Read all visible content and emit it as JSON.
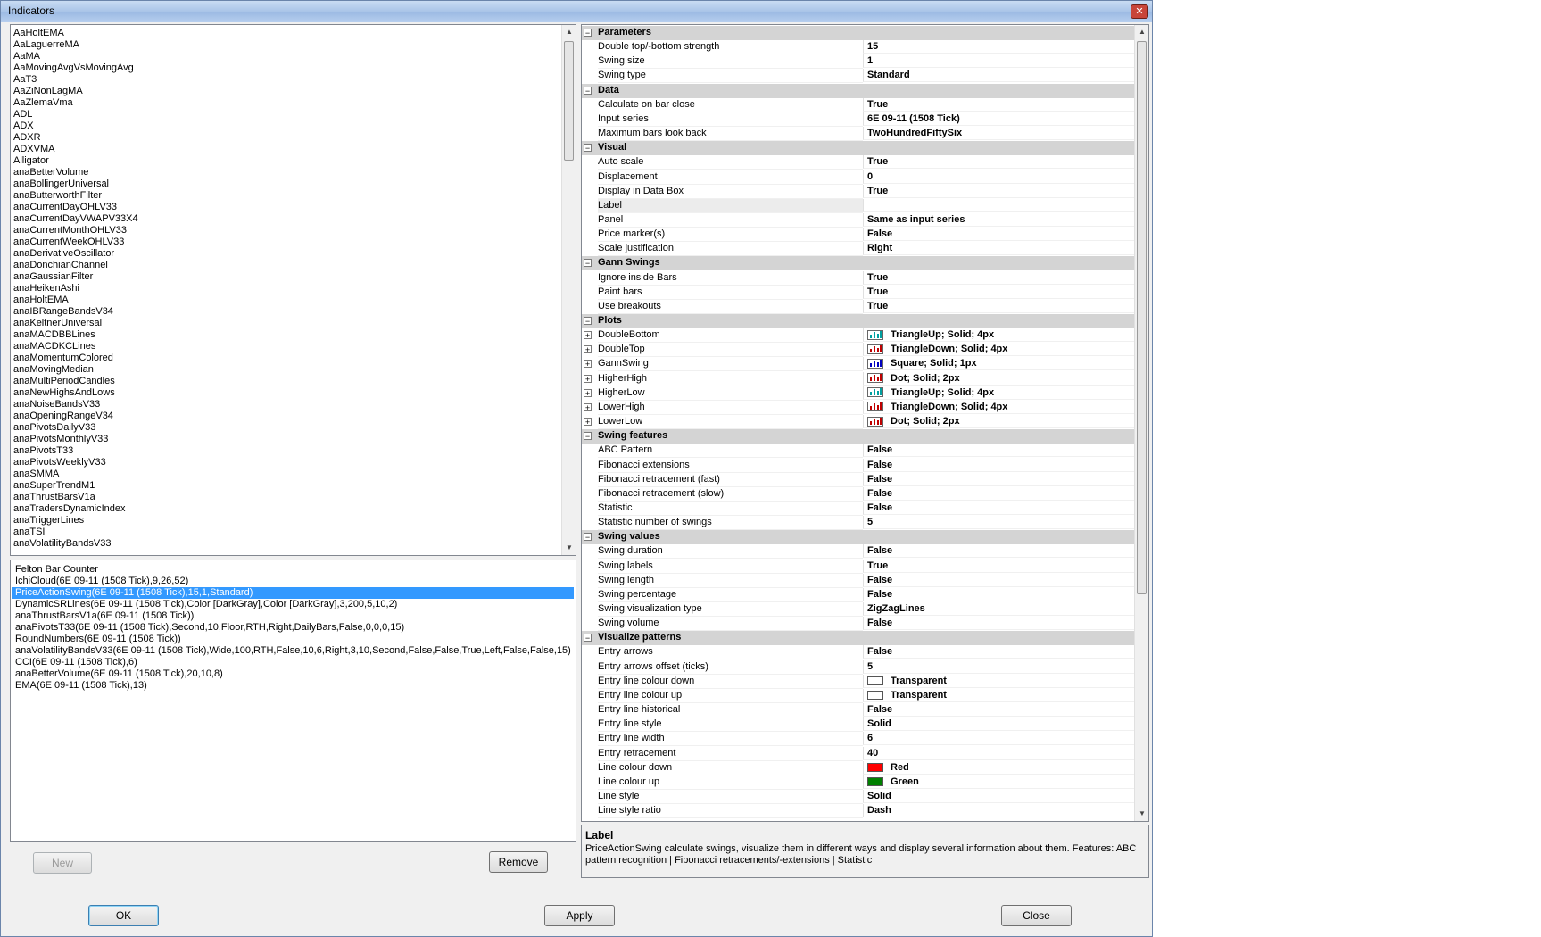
{
  "window": {
    "title": "Indicators",
    "close_glyph": "✕"
  },
  "indicator_list": [
    "AaHoltEMA",
    "AaLaguerreMA",
    "AaMA",
    "AaMovingAvgVsMovingAvg",
    "AaT3",
    "AaZiNonLagMA",
    "AaZlemaVma",
    "ADL",
    "ADX",
    "ADXR",
    "ADXVMA",
    "Alligator",
    "anaBetterVolume",
    "anaBollingerUniversal",
    "anaButterworthFilter",
    "anaCurrentDayOHLV33",
    "anaCurrentDayVWAPV33X4",
    "anaCurrentMonthOHLV33",
    "anaCurrentWeekOHLV33",
    "anaDerivativeOscillator",
    "anaDonchianChannel",
    "anaGaussianFilter",
    "anaHeikenAshi",
    "anaHoltEMA",
    "anaIBRangeBandsV34",
    "anaKeltnerUniversal",
    "anaMACDBBLines",
    "anaMACDKCLines",
    "anaMomentumColored",
    "anaMovingMedian",
    "anaMultiPeriodCandles",
    "anaNewHighsAndLows",
    "anaNoiseBandsV33",
    "anaOpeningRangeV34",
    "anaPivotsDailyV33",
    "anaPivotsMonthlyV33",
    "anaPivotsT33",
    "anaPivotsWeeklyV33",
    "anaSMMA",
    "anaSuperTrendM1",
    "anaThrustBarsV1a",
    "anaTradersDynamicIndex",
    "anaTriggerLines",
    "anaTSI",
    "anaVolatilityBandsV33"
  ],
  "applied_list": {
    "selected_index": 2,
    "items": [
      "Felton Bar Counter",
      "IchiCloud(6E 09-11 (1508 Tick),9,26,52)",
      "PriceActionSwing(6E 09-11 (1508 Tick),15,1,Standard)",
      "DynamicSRLines(6E 09-11 (1508 Tick),Color [DarkGray],Color [DarkGray],3,200,5,10,2)",
      "anaThrustBarsV1a(6E 09-11 (1508 Tick))",
      "anaPivotsT33(6E 09-11 (1508 Tick),Second,10,Floor,RTH,Right,DailyBars,False,0,0,0,15)",
      "RoundNumbers(6E 09-11 (1508 Tick))",
      "anaVolatilityBandsV33(6E 09-11 (1508 Tick),Wide,100,RTH,False,10,6,Right,3,10,Second,False,False,True,Left,False,False,15)",
      "CCI(6E 09-11 (1508 Tick),6)",
      "anaBetterVolume(6E 09-11 (1508 Tick),20,10,8)",
      "EMA(6E 09-11 (1508 Tick),13)"
    ]
  },
  "buttons": {
    "new": "New",
    "remove": "Remove",
    "ok": "OK",
    "apply": "Apply",
    "close": "Close"
  },
  "property_grid": [
    {
      "category": "Parameters",
      "props": [
        {
          "name": "Double top/-bottom strength",
          "value": "15"
        },
        {
          "name": "Swing size",
          "value": "1"
        },
        {
          "name": "Swing type",
          "value": "Standard"
        }
      ]
    },
    {
      "category": "Data",
      "props": [
        {
          "name": "Calculate on bar close",
          "value": "True"
        },
        {
          "name": "Input series",
          "value": "6E 09-11 (1508 Tick)"
        },
        {
          "name": "Maximum bars look back",
          "value": "TwoHundredFiftySix"
        }
      ]
    },
    {
      "category": "Visual",
      "props": [
        {
          "name": "Auto scale",
          "value": "True"
        },
        {
          "name": "Displacement",
          "value": "0"
        },
        {
          "name": "Display in Data Box",
          "value": "True"
        },
        {
          "name": "Label",
          "value": "",
          "shaded": true
        },
        {
          "name": "Panel",
          "value": "Same as input series"
        },
        {
          "name": "Price marker(s)",
          "value": "False"
        },
        {
          "name": "Scale justification",
          "value": "Right"
        }
      ]
    },
    {
      "category": "Gann Swings",
      "props": [
        {
          "name": "Ignore inside Bars",
          "value": "True"
        },
        {
          "name": "Paint bars",
          "value": "True"
        },
        {
          "name": "Use breakouts",
          "value": "True"
        }
      ]
    },
    {
      "category": "Plots",
      "props": [
        {
          "name": "DoubleBottom",
          "value": "TriangleUp; Solid; 4px",
          "expand": true,
          "plot_color": "#00a0a0"
        },
        {
          "name": "DoubleTop",
          "value": "TriangleDown; Solid; 4px",
          "expand": true,
          "plot_color": "#c00000"
        },
        {
          "name": "GannSwing",
          "value": "Square; Solid; 1px",
          "expand": true,
          "plot_color": "#0000c0"
        },
        {
          "name": "HigherHigh",
          "value": "Dot; Solid; 2px",
          "expand": true,
          "plot_color": "#c00000"
        },
        {
          "name": "HigherLow",
          "value": "TriangleUp; Solid; 4px",
          "expand": true,
          "plot_color": "#00a0a0"
        },
        {
          "name": "LowerHigh",
          "value": "TriangleDown; Solid; 4px",
          "expand": true,
          "plot_color": "#c00000"
        },
        {
          "name": "LowerLow",
          "value": "Dot; Solid; 2px",
          "expand": true,
          "plot_color": "#c00000"
        }
      ]
    },
    {
      "category": "Swing features",
      "props": [
        {
          "name": "ABC Pattern",
          "value": "False"
        },
        {
          "name": "Fibonacci extensions",
          "value": "False"
        },
        {
          "name": "Fibonacci retracement (fast)",
          "value": "False"
        },
        {
          "name": "Fibonacci retracement (slow)",
          "value": "False"
        },
        {
          "name": "Statistic",
          "value": "False"
        },
        {
          "name": "Statistic number of swings",
          "value": "5"
        }
      ]
    },
    {
      "category": "Swing values",
      "props": [
        {
          "name": "Swing duration",
          "value": "False"
        },
        {
          "name": "Swing labels",
          "value": "True"
        },
        {
          "name": "Swing length",
          "value": "False"
        },
        {
          "name": "Swing percentage",
          "value": "False"
        },
        {
          "name": "Swing visualization type",
          "value": "ZigZagLines"
        },
        {
          "name": "Swing volume",
          "value": "False"
        }
      ]
    },
    {
      "category": "Visualize patterns",
      "props": [
        {
          "name": "Entry arrows",
          "value": "False"
        },
        {
          "name": "Entry arrows offset (ticks)",
          "value": "5"
        },
        {
          "name": "Entry line colour down",
          "value": "Transparent",
          "color": "#ffffff"
        },
        {
          "name": "Entry line colour up",
          "value": "Transparent",
          "color": "#ffffff"
        },
        {
          "name": "Entry line historical",
          "value": "False"
        },
        {
          "name": "Entry line style",
          "value": "Solid"
        },
        {
          "name": "Entry line width",
          "value": "6"
        },
        {
          "name": "Entry retracement",
          "value": "40"
        },
        {
          "name": "Line colour down",
          "value": "Red",
          "color": "#ff0000"
        },
        {
          "name": "Line colour up",
          "value": "Green",
          "color": "#008000"
        },
        {
          "name": "Line style",
          "value": "Solid"
        },
        {
          "name": "Line style ratio",
          "value": "Dash"
        }
      ]
    }
  ],
  "description": {
    "title": "Label",
    "text": "PriceActionSwing calculate swings, visualize them in different ways and display several information about them. Features: ABC pattern recognition | Fibonacci retracements/-extensions | Statistic"
  }
}
